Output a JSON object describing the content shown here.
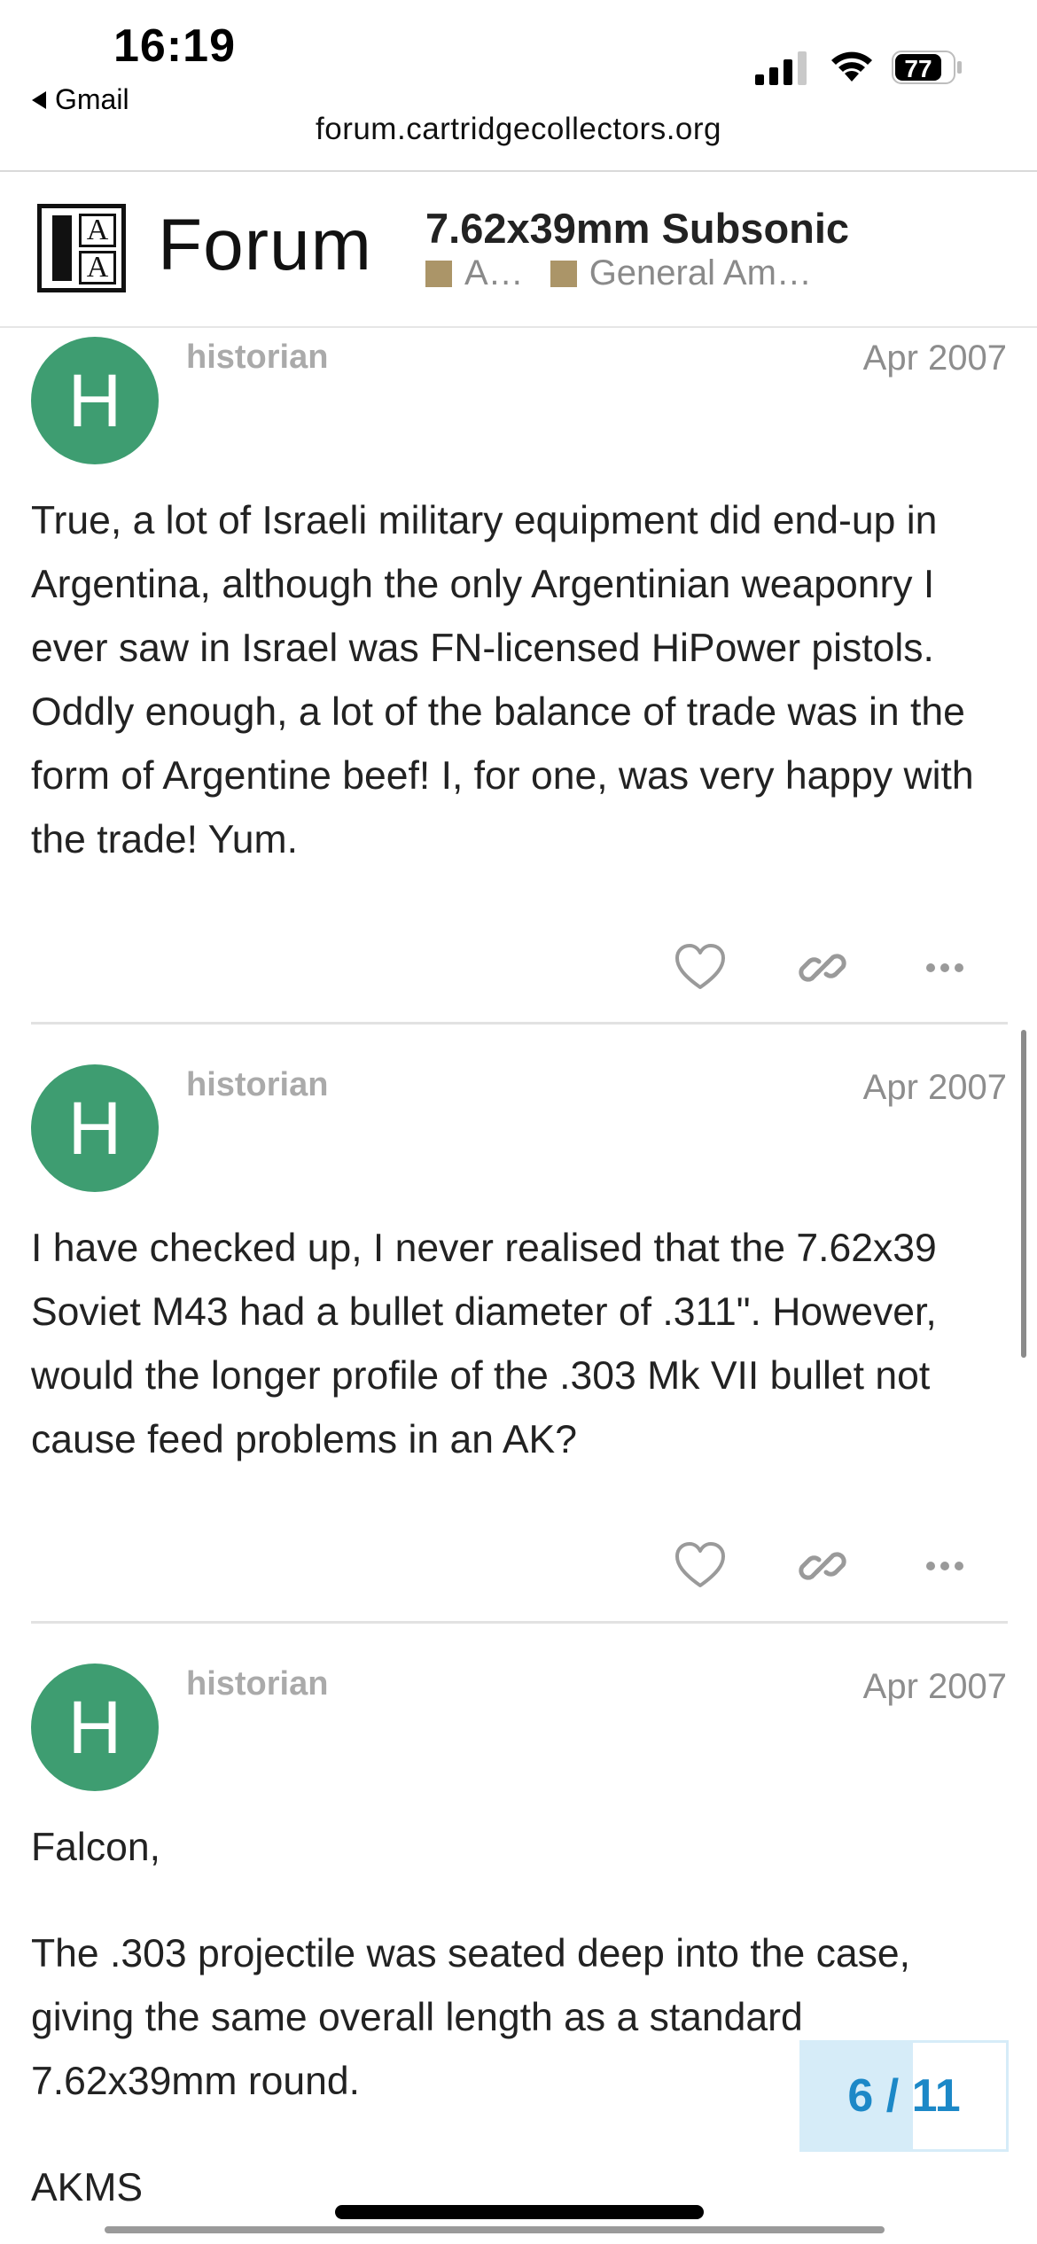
{
  "status_bar": {
    "time": "16:19",
    "back_label": "Gmail",
    "battery": "77",
    "url": "forum.cartridgecollectors.org"
  },
  "header": {
    "logo_letters": [
      "A",
      "A"
    ],
    "forum_word": "Forum",
    "topic_title": "7.62x39mm Subsonic",
    "category_1": "A…",
    "category_2": "General Am…",
    "category_color": "#ab9568"
  },
  "posts": [
    {
      "avatar_letter": "H",
      "avatar_color": "#3e9d71",
      "username": "historian",
      "date": "Apr 2007",
      "paragraphs": [
        "True, a lot of Israeli military equipment did end-up in Argentina, although the only Argentinian weaponry I ever saw in Israel was FN-licensed HiPower pistols. Oddly enough, a lot of the balance of trade was in the form of Argentine beef! I, for one, was very happy with the trade! Yum."
      ],
      "actions": [
        "heart-icon",
        "link-icon",
        "more-icon"
      ]
    },
    {
      "avatar_letter": "H",
      "avatar_color": "#3e9d71",
      "username": "historian",
      "date": "Apr 2007",
      "paragraphs": [
        "I have checked up, I never realised that the 7.62x39 Soviet M43 had a bullet diameter of .311\". However, would the longer profile of the .303 Mk VII bullet not cause feed problems in an AK?"
      ],
      "actions": [
        "heart-icon",
        "link-icon",
        "more-icon"
      ]
    },
    {
      "avatar_letter": "H",
      "avatar_color": "#3e9d71",
      "username": "historian",
      "date": "Apr 2007",
      "paragraphs": [
        "Falcon,",
        "The .303 projectile was seated deep into the case, giving the same overall length as a standard 7.62x39mm round.",
        "AKMS"
      ]
    }
  ],
  "progress": {
    "label": "6 / 11",
    "current": 6,
    "total": 11,
    "accent": "#1c88c7",
    "fill_color": "#d6ecf8"
  }
}
